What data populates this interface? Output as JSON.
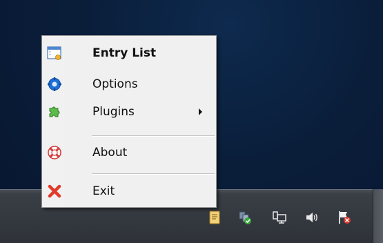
{
  "menu": {
    "items": [
      {
        "label": "Entry List",
        "icon": "entry-list-icon",
        "bold": true
      },
      {
        "label": "Options",
        "icon": "options-gear-icon"
      },
      {
        "label": "Plugins",
        "icon": "plugins-puzzle-icon",
        "submenu": true
      },
      {
        "label": "About",
        "icon": "about-lifebuoy-icon"
      },
      {
        "label": "Exit",
        "icon": "exit-x-icon"
      }
    ]
  },
  "tray": {
    "icons": [
      "notes-icon",
      "network-status-icon",
      "network-monitor-icon",
      "volume-icon",
      "action-center-flag-icon"
    ]
  },
  "colors": {
    "desktop": "#0a1e3a",
    "menu_bg": "#f0f0f0",
    "taskbar": "#343940",
    "exit_red": "#e23a2a",
    "options_blue": "#1e6fd8",
    "plugin_green": "#3fa535"
  }
}
